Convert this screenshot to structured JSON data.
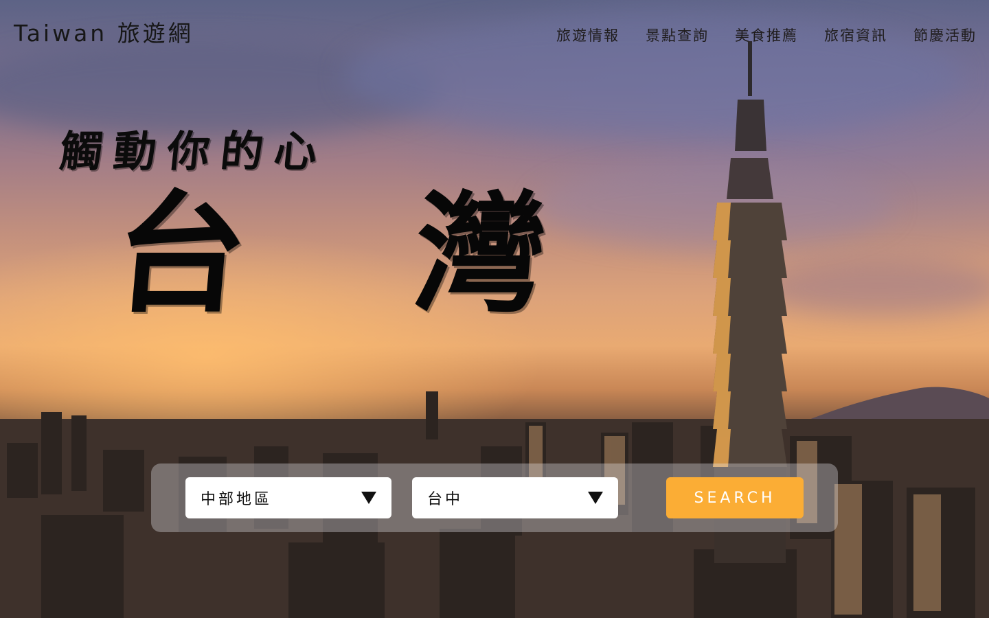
{
  "header": {
    "brand": "Taiwan 旅遊網",
    "nav": [
      "旅遊情報",
      "景點查詢",
      "美食推薦",
      "旅宿資訊",
      "節慶活動"
    ]
  },
  "hero": {
    "tagline": "觸動你的心",
    "title": "台 灣"
  },
  "search": {
    "region_value": "中部地區",
    "city_value": "台中",
    "button_label": "SEARCH"
  },
  "colors": {
    "button": "#fbad35",
    "text_dark": "#111111"
  },
  "icons": {
    "dropdown": "caret-down-icon"
  }
}
